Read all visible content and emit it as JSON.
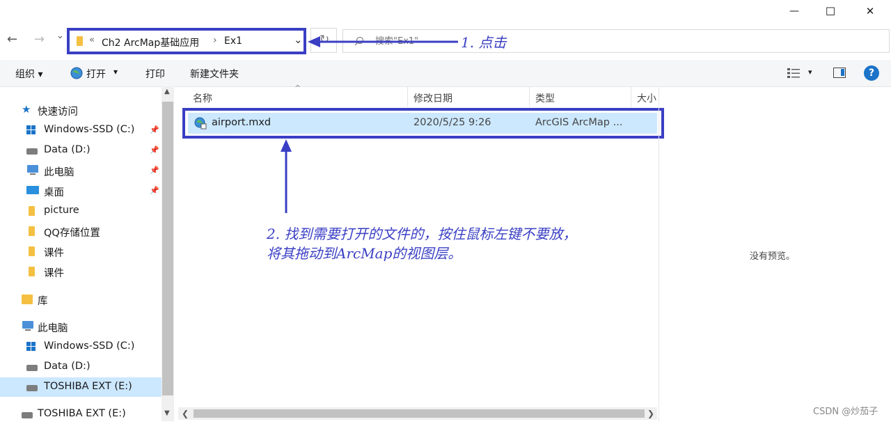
{
  "window": {
    "min_label": "—",
    "max_label": "☐",
    "close_label": "✕"
  },
  "nav_buttons": {
    "back": "←",
    "forward": "→",
    "recent": "⌄",
    "up": "↑"
  },
  "address": {
    "overflow": "«",
    "crumbs": [
      "Ch2  ArcMap基础应用",
      "Ex1"
    ],
    "separator": "›",
    "dropdown": "⌄"
  },
  "refresh": "↻",
  "search": {
    "placeholder": "搜索\"Ex1\""
  },
  "toolbar": {
    "organize": "组织 ▾",
    "open": "打开",
    "open_arrow": "▾",
    "print": "打印",
    "new_folder": "新建文件夹",
    "view_arrow": "▾",
    "help": "?"
  },
  "sidebar": {
    "quick_access": "快速访问",
    "quick_items": [
      {
        "label": "Windows-SSD (C:)"
      },
      {
        "label": "Data (D:)"
      },
      {
        "label": "此电脑"
      },
      {
        "label": "桌面"
      },
      {
        "label": "picture"
      },
      {
        "label": "QQ存储位置"
      },
      {
        "label": "课件"
      },
      {
        "label": "课件"
      }
    ],
    "library": "库",
    "this_pc": "此电脑",
    "pc_items": [
      {
        "label": "Windows-SSD (C:)"
      },
      {
        "label": "Data (D:)"
      },
      {
        "label": "TOSHIBA EXT (E:)"
      }
    ],
    "external": "TOSHIBA EXT (E:)"
  },
  "columns": {
    "name": "名称",
    "modified": "修改日期",
    "type": "类型",
    "size": "大小",
    "sort_arrow": "^"
  },
  "files": [
    {
      "name": "airport.mxd",
      "modified": "2020/5/25 9:26",
      "type": "ArcGIS ArcMap ..."
    }
  ],
  "preview": {
    "empty": "没有预览。"
  },
  "annotations": {
    "step1": "1. 点击",
    "step2_line1": "2. 找到需要打开的文件的，按住鼠标左键不要放，",
    "step2_line2": "将其拖动到ArcMap的视图层。"
  },
  "watermark": "CSDN @炒茄子",
  "colors": {
    "annotation": "#3a3fc4",
    "selection": "#cce8ff",
    "folder": "#f4c042",
    "help": "#1a73c8"
  }
}
